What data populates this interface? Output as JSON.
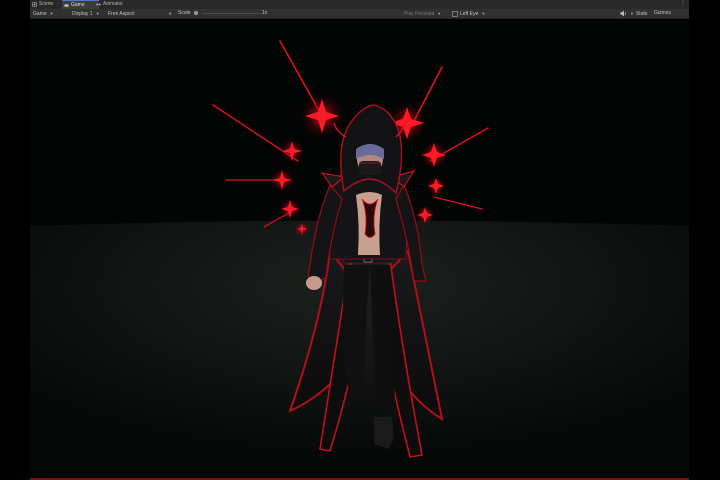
{
  "tabs": [
    {
      "label": "Scene",
      "icon": "scene-grid-icon",
      "active": false
    },
    {
      "label": "Game",
      "icon": "game-pad-icon",
      "active": true
    },
    {
      "label": "Animator",
      "icon": "animator-icon",
      "active": false
    }
  ],
  "toolbar": {
    "display_mode": "Game",
    "display": "Display 1",
    "aspect": "Free Aspect",
    "scale_label": "Scale",
    "scale_value": "1x",
    "play_mode": "Play Focused",
    "eye": "Left Eye",
    "stats_label": "Stats",
    "gizmos_label": "Gizmos",
    "mute_icon": "speaker-icon"
  },
  "colors": {
    "accent_red": "#e0101c",
    "dark_red": "#8a0a10",
    "editor_bg": "#303030"
  }
}
